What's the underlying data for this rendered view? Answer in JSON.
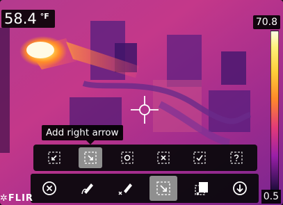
{
  "readout": {
    "value": "58.4",
    "unit": "°F"
  },
  "scale": {
    "max": "70.8",
    "min": "0.5"
  },
  "tooltip": {
    "text": "Add right arrow"
  },
  "arrow_menu": {
    "options": [
      {
        "name": "down-left-arrow",
        "selected": false
      },
      {
        "name": "down-right-arrow",
        "selected": true
      },
      {
        "name": "circle-marker",
        "selected": false
      },
      {
        "name": "x-marker",
        "selected": false
      },
      {
        "name": "checkmark-marker",
        "selected": false
      },
      {
        "name": "question-marker",
        "selected": false
      }
    ]
  },
  "toolbar": {
    "tools": [
      {
        "name": "cancel-icon",
        "active": false
      },
      {
        "name": "pen-icon",
        "active": false
      },
      {
        "name": "eraser-pen-icon",
        "active": false
      },
      {
        "name": "arrow-stamp-icon",
        "active": true
      },
      {
        "name": "clear-stamp-icon",
        "active": false
      },
      {
        "name": "save-download-icon",
        "active": false
      }
    ]
  },
  "brand": {
    "logo_text": "FLIR"
  },
  "colors": {
    "hot": "#fff8c8",
    "mid": "#e8437a",
    "cold": "#3a1a66",
    "selected_bg": "#8f8f8f"
  }
}
